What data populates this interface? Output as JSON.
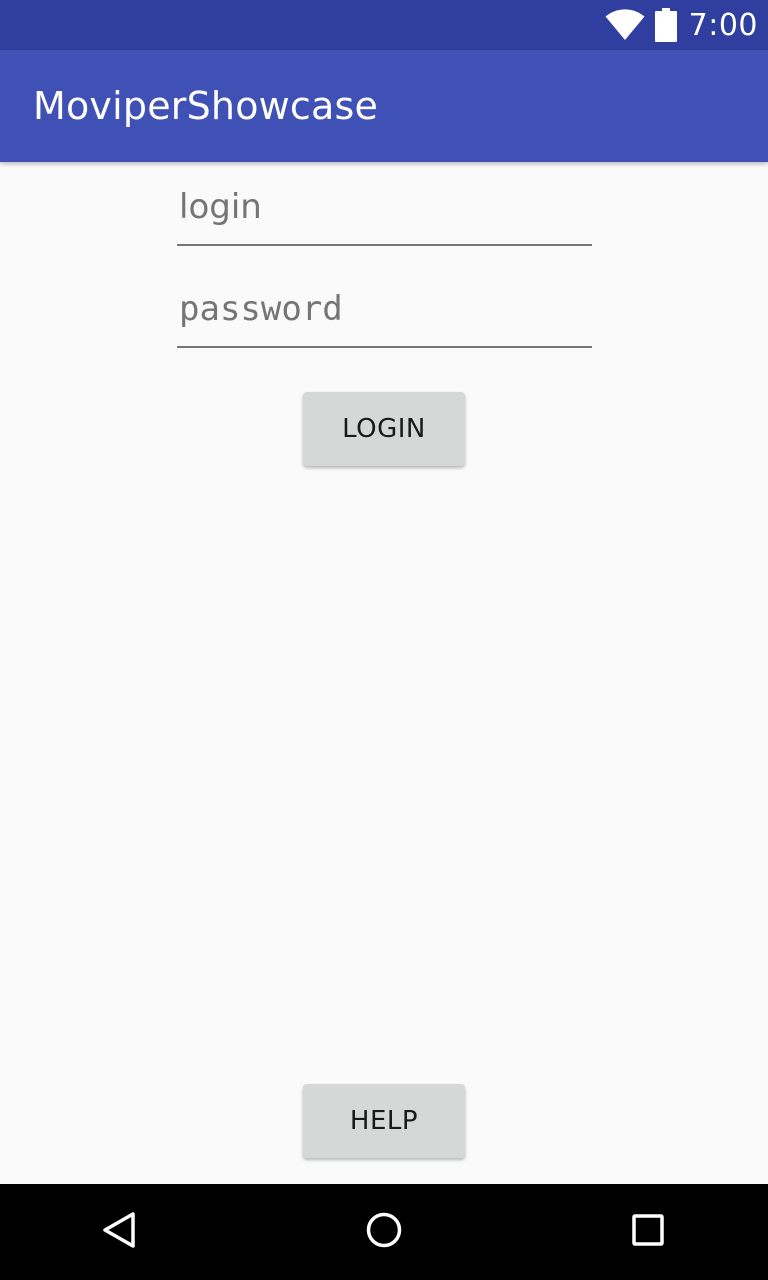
{
  "status_bar": {
    "time": "7:00",
    "icons": [
      "wifi-icon",
      "battery-icon"
    ],
    "background": "#303f9f"
  },
  "app_bar": {
    "title": "MoviperShowcase",
    "background": "#3f51b5"
  },
  "form": {
    "login_placeholder": "login",
    "login_value": "",
    "password_placeholder": "password",
    "password_value": "",
    "login_button_label": "LOGIN"
  },
  "footer": {
    "help_button_label": "HELP"
  },
  "nav_bar": {
    "icons": [
      "back-icon",
      "home-icon",
      "recents-icon"
    ]
  },
  "colors": {
    "page_background": "#fafafa",
    "button_background": "#d6d7d7",
    "hint_text": "#757575"
  }
}
